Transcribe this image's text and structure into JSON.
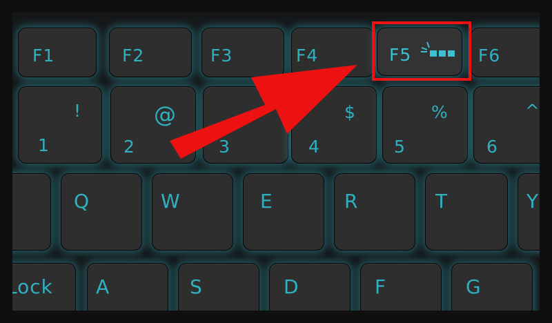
{
  "function_row": {
    "f1": "F1",
    "f2": "F2",
    "f3": "F3",
    "f4": "F4",
    "f5": "F5",
    "f6": "F6",
    "f5_icon": "keyboard-backlight-icon"
  },
  "number_row": {
    "k1": {
      "top": "!",
      "bottom": "1"
    },
    "k2": {
      "top": "@",
      "bottom": "2"
    },
    "k3": {
      "top": "",
      "bottom": "3"
    },
    "k4": {
      "top": "$",
      "bottom": "4"
    },
    "k5": {
      "top": "%",
      "bottom": "5"
    },
    "k6": {
      "top": "^",
      "bottom": "6"
    }
  },
  "qwerty_row": [
    "Q",
    "W",
    "E",
    "R",
    "T",
    "Y"
  ],
  "home_row": {
    "caps": "Lock",
    "keys": [
      "A",
      "S",
      "D",
      "F",
      "G"
    ]
  },
  "colors": {
    "key_surface": "#2e2e2e",
    "legend": "#2fb1c2",
    "glow": "#38b9cd",
    "highlight": "#ee1111",
    "arrow": "#ee1111"
  }
}
